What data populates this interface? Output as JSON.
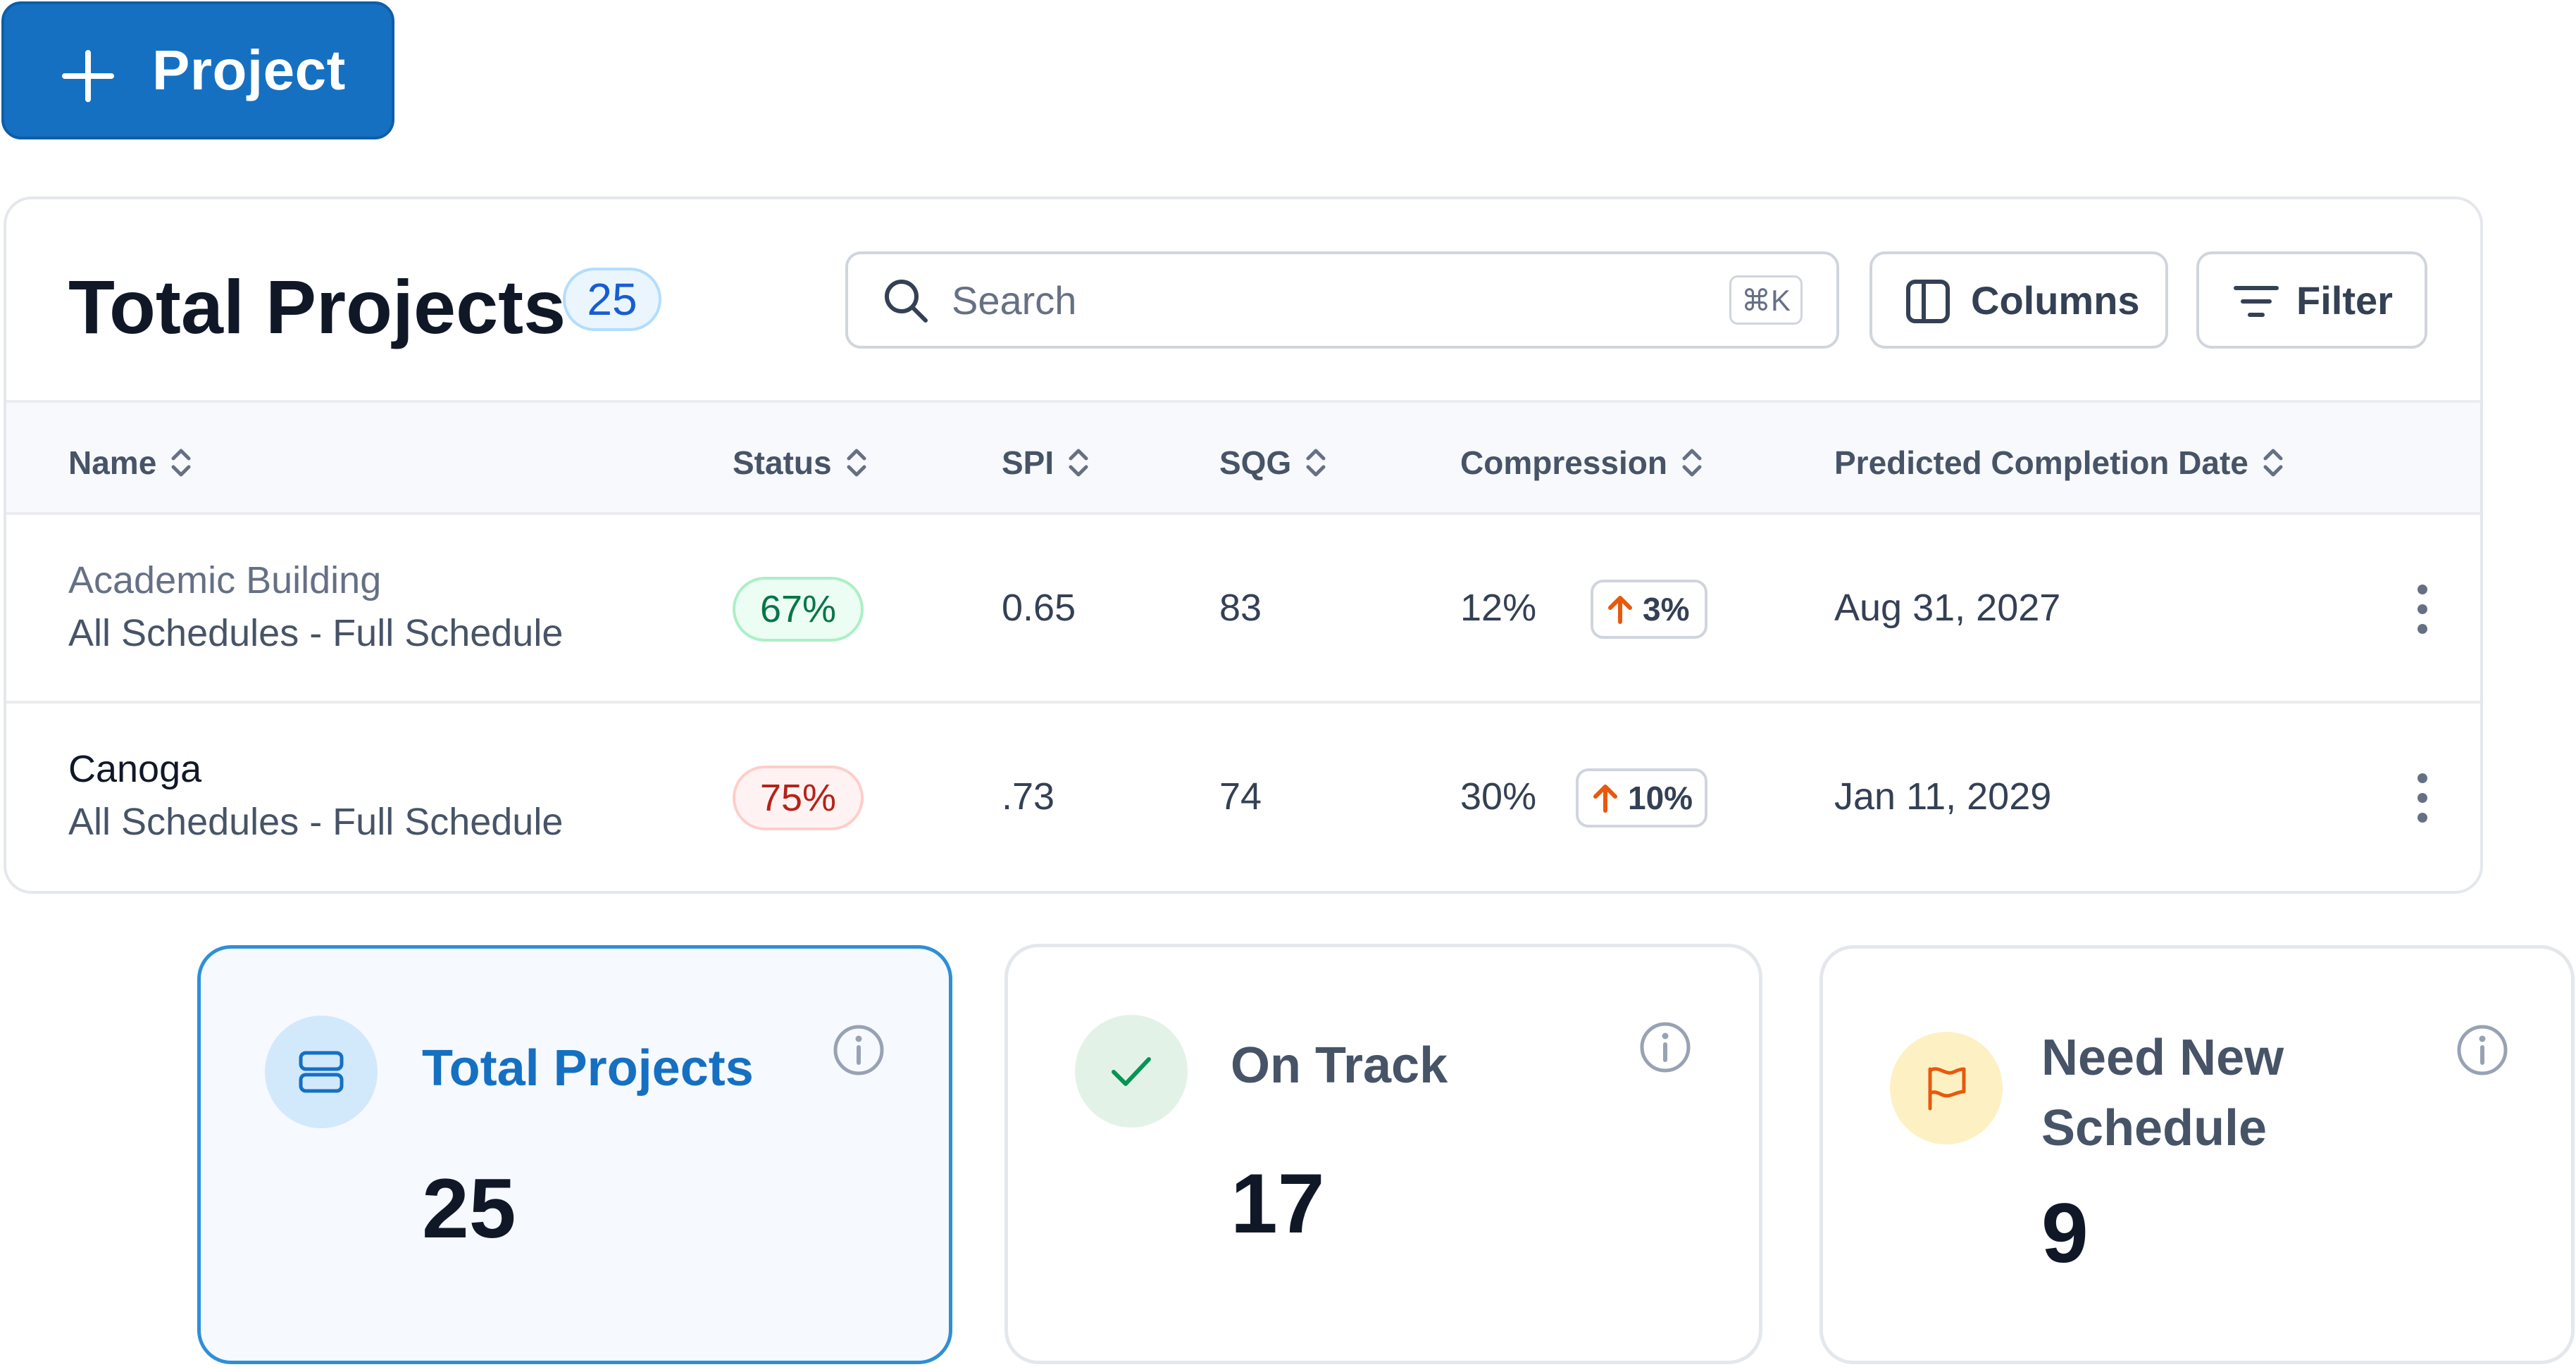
{
  "new_project_button": {
    "label": "Project"
  },
  "table": {
    "title": "Total Projects",
    "count": "25",
    "search": {
      "placeholder": "Search",
      "value": "",
      "shortcut": "⌘K"
    },
    "columns_button": "Columns",
    "filter_button": "Filter",
    "headers": {
      "name": "Name",
      "status": "Status",
      "spi": "SPI",
      "sqg": "SQG",
      "compression": "Compression",
      "predicted_completion": "Predicted Completion Date"
    },
    "rows": [
      {
        "name": "Academic Building",
        "schedule": "All Schedules - Full Schedule",
        "status": "67%",
        "status_color": "#067647",
        "spi": "0.65",
        "sqg": "83",
        "compression": "12%",
        "compression_delta": "3%",
        "completion_date": "Aug 31, 2027"
      },
      {
        "name": "Canoga",
        "schedule": "All Schedules - Full Schedule",
        "status": "75%",
        "status_color": "#b42318",
        "spi": ".73",
        "sqg": "74",
        "compression": "30%",
        "compression_delta": "10%",
        "completion_date": "Jan 11, 2029"
      }
    ]
  },
  "stats": [
    {
      "title": "Total Projects",
      "value": "25",
      "icon": "server-stack-icon",
      "accent": "#1570c2"
    },
    {
      "title": "On Track",
      "value": "17",
      "icon": "check-icon",
      "accent": "#079455"
    },
    {
      "title_line1": "Need New",
      "title_line2": "Schedule",
      "value": "9",
      "icon": "flag-icon",
      "accent": "#e8590c"
    }
  ],
  "colors": {
    "primary": "#1570c2",
    "delta_up": "#e8590c",
    "status_good": "#067647",
    "status_bad": "#b42318"
  }
}
